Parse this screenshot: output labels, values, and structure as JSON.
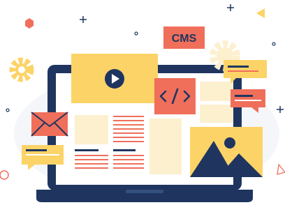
{
  "illustration": {
    "cms_badge_label": "CMS",
    "code_icon_glyph": "</>",
    "icons": [
      "play-icon",
      "code-icon",
      "mail-icon",
      "gear-icon",
      "image-icon",
      "plus-icon",
      "ring-icon",
      "triangle-icon"
    ],
    "colors": {
      "navy": "#1f3560",
      "coral": "#ef6f5b",
      "yellow": "#fcd367",
      "cream": "#fdf0cf",
      "light_bg": "#f2f4f8"
    }
  }
}
